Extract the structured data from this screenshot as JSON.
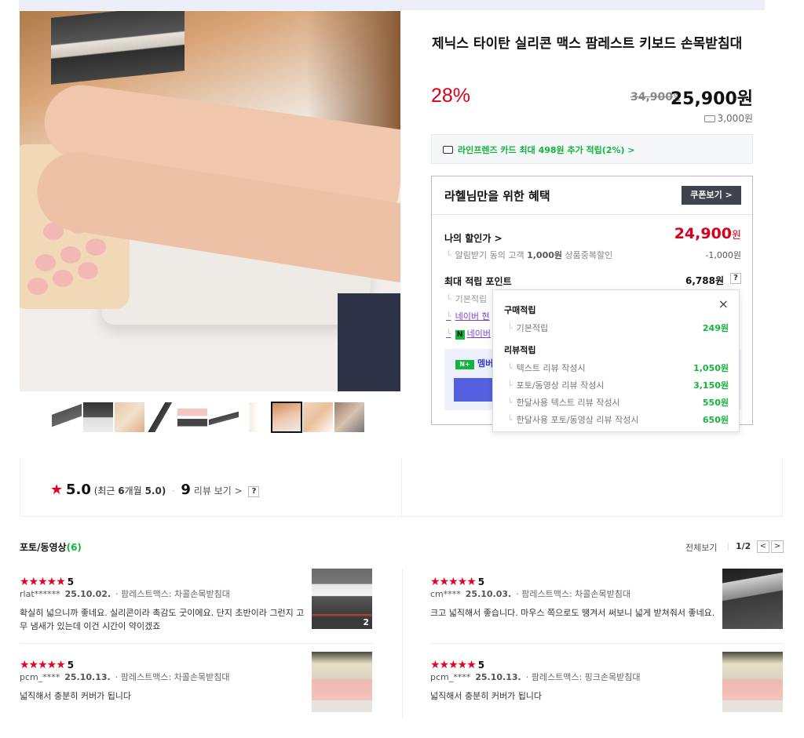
{
  "product": {
    "title": "제닉스 타이탄 실리콘 맥스 팜레스트 키보드 손목받침대",
    "discount_rate": "28%",
    "original_price": "34,900",
    "original_unit": "원",
    "sale_price": "25,900원",
    "shipping": "3,000원",
    "card_benefit": "라인프렌즈 카드 최대 498원 추가 적립(2%) >"
  },
  "benefit": {
    "title": "라헬님만을 위한 혜택",
    "coupon_button": "쿠폰보기 >",
    "my_discount_label": "나의 할인가 >",
    "my_discount_price": "24,900",
    "my_discount_unit": "원",
    "my_discount_sub_prefix": "알림받기 동의 고객",
    "my_discount_sub_amount": "1,000원",
    "my_discount_sub_suffix": "상품중복할인",
    "my_discount_sub_value": "-1,000원",
    "max_point_label": "최대 적립 포인트",
    "max_point_value": "6,788원",
    "help": "?",
    "point_lines": [
      "기본적립",
      "네이버 현",
      "네이버"
    ],
    "member_text": "멤버"
  },
  "popup": {
    "close": "×",
    "purchase_section": "구매적립",
    "purchase_rows": [
      {
        "label": "기본적립",
        "value": "249원"
      }
    ],
    "review_section": "리뷰적립",
    "review_rows": [
      {
        "label": "텍스트 리뷰 작성시",
        "value": "1,050원"
      },
      {
        "label": "포토/동영상 리뷰 작성시",
        "value": "3,150원"
      },
      {
        "label": "한달사용 텍스트 리뷰 작성시",
        "value": "550원"
      },
      {
        "label": "한달사용 포토/동영상 리뷰 작성시",
        "value": "650원"
      }
    ]
  },
  "rating": {
    "score": "5.0",
    "recent_prefix": "(최근",
    "recent_months": "6",
    "recent_mid": "개월",
    "recent_score": "5.0)",
    "dot": "·",
    "review_count": "9",
    "review_link": "리뷰 보기 >",
    "help": "?"
  },
  "photo_reviews": {
    "title": "포토/동영상",
    "count": "(6)",
    "view_all": "전체보기",
    "page": "1/2",
    "prev": "<",
    "next": ">",
    "items": [
      {
        "stars": "★★★★★",
        "score": "5",
        "user": "rlat******",
        "date": "25.10.02.",
        "option": "팜레스트맥스: 차콜손목받침대",
        "text": "확실히 넓으니까 좋네요. 실리콘이라 촉감도 굿이에요. 단지 초반이라 그런지 고무 냄새가 있는데 이건 시간이 약이겠죠",
        "image_count": "2"
      },
      {
        "stars": "★★★★★",
        "score": "5",
        "user": "cm****",
        "date": "25.10.03.",
        "option": "팜레스트맥스: 차콜손목받침대",
        "text": "크고 넓직해서 좋습니다. 마우스 쪽으로도 땡겨서 써보니 넓게 받쳐줘서 좋네요.",
        "image_count": ""
      },
      {
        "stars": "★★★★★",
        "score": "5",
        "user": "pcm_****",
        "date": "25.10.13.",
        "option": "팜레스트맥스: 차콜손목받침대",
        "text": "넓직해서 충분히 커버가 됩니다",
        "image_count": ""
      },
      {
        "stars": "★★★★★",
        "score": "5",
        "user": "pcm_****",
        "date": "25.10.13.",
        "option": "팜레스트맥스: 핑크손목받침대",
        "text": "넓직해서 충분히 커버가 됩니다",
        "image_count": ""
      }
    ]
  },
  "colors": {
    "accent_red": "#d6001c",
    "naver_green": "#12b53c",
    "coupon_dark": "#3f434d",
    "member_blue": "#5560e0"
  }
}
